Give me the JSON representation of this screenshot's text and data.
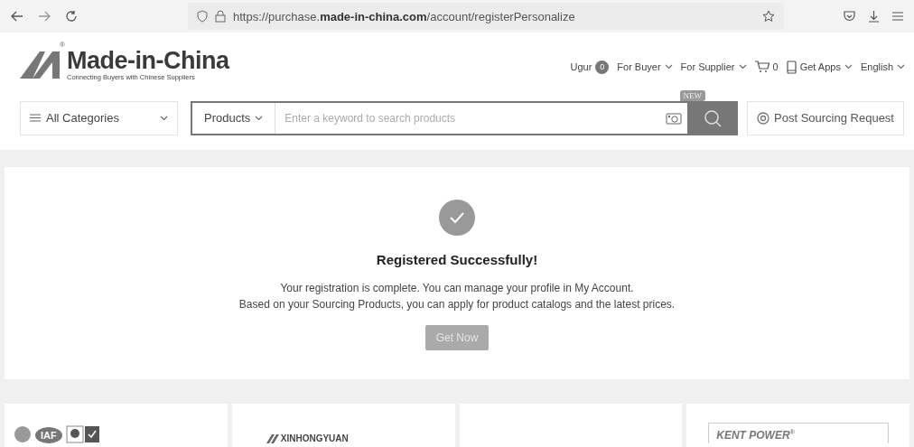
{
  "browser": {
    "url_prefix": "https://purchase.",
    "url_domain": "made-in-china.com",
    "url_path": "/account/registerPersonalize"
  },
  "logo": {
    "name": "Made-in-China",
    "registered": "®",
    "tagline": "Connecting Buyers with Chinese Suppliers"
  },
  "top_nav": [
    {
      "kind": "user",
      "label": "Ugur",
      "badge": "0"
    },
    {
      "kind": "menu",
      "label": "For Buyer"
    },
    {
      "kind": "menu",
      "label": "For Supplier"
    },
    {
      "kind": "cart",
      "label": "0"
    },
    {
      "kind": "apps",
      "label": "Get Apps"
    },
    {
      "kind": "menu",
      "label": "English"
    }
  ],
  "search": {
    "categories": "All Categories",
    "scope": "Products",
    "placeholder": "Enter a keyword to search products",
    "new_badge": "NEW",
    "post_request": "Post Sourcing Request"
  },
  "result": {
    "title": "Registered Successfully!",
    "lines": [
      "Your registration is complete. You can manage your profile in My Account.",
      "Based on your Sourcing Products, you can apply for product catalogs and the latest prices."
    ],
    "button": "Get Now",
    "button_disabled": true
  },
  "supplier_cards": [
    {
      "kind": "certs",
      "label": "IAF"
    },
    {
      "kind": "brand",
      "label": "XINHONGYUAN"
    },
    {
      "kind": "empty"
    },
    {
      "kind": "brand_box",
      "label": "KENT POWER",
      "mark": "®"
    }
  ]
}
